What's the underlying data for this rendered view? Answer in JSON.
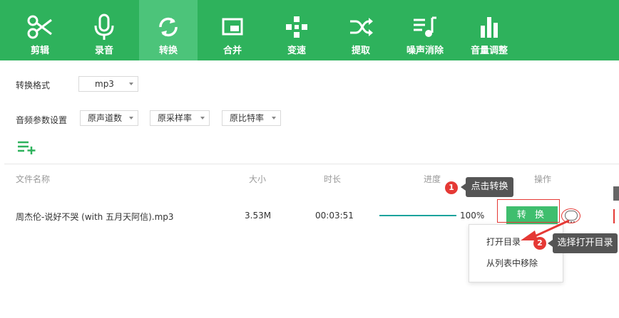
{
  "toolbar": {
    "items": [
      {
        "label": "剪辑",
        "icon": "scissors-icon"
      },
      {
        "label": "录音",
        "icon": "microphone-icon"
      },
      {
        "label": "转换",
        "icon": "refresh-icon",
        "active": true
      },
      {
        "label": "合并",
        "icon": "merge-icon"
      },
      {
        "label": "变速",
        "icon": "speed-icon"
      },
      {
        "label": "提取",
        "icon": "shuffle-icon"
      },
      {
        "label": "噪声消除",
        "icon": "music-note-icon"
      },
      {
        "label": "音量调整",
        "icon": "bar-chart-icon"
      }
    ]
  },
  "settings": {
    "format_label": "转换格式",
    "format_value": "mp3",
    "audio_params_label": "音频参数设置",
    "channels_value": "原声道数",
    "samplerate_value": "原采样率",
    "bitrate_value": "原比特率"
  },
  "table": {
    "headers": {
      "name": "文件名称",
      "size": "大小",
      "duration": "时长",
      "progress": "进度",
      "action": "操作"
    },
    "rows": [
      {
        "name": "周杰伦-说好不哭 (with 五月天阿信).mp3",
        "size": "3.53M",
        "duration": "00:03:51",
        "progress": 1.0,
        "progress_text": "100%",
        "action": "转 换"
      }
    ]
  },
  "context_menu": {
    "items": [
      "打开目录",
      "从列表中移除"
    ]
  },
  "callouts": {
    "step1_badge": "1",
    "step1_text": "点击转换",
    "step2_badge": "2",
    "step2_text": "选择打开目录"
  },
  "colors": {
    "brand": "#2eb25c",
    "accent_active": "#4cc47a",
    "button": "#3fbe6e",
    "progress": "#1ba39c",
    "annotation": "#e53935"
  }
}
